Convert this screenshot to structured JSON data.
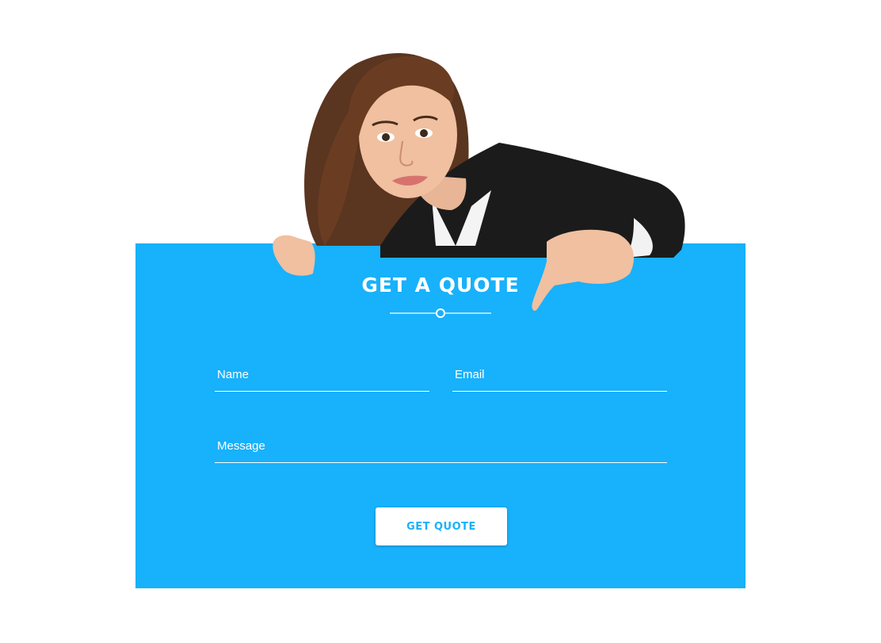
{
  "form": {
    "title": "GET A QUOTE",
    "name_placeholder": "Name",
    "email_placeholder": "Email",
    "message_placeholder": "Message",
    "submit_label": "GET QUOTE"
  },
  "colors": {
    "panel_bg": "#18b1fb",
    "text": "#ffffff",
    "button_text": "#18b1fb"
  }
}
